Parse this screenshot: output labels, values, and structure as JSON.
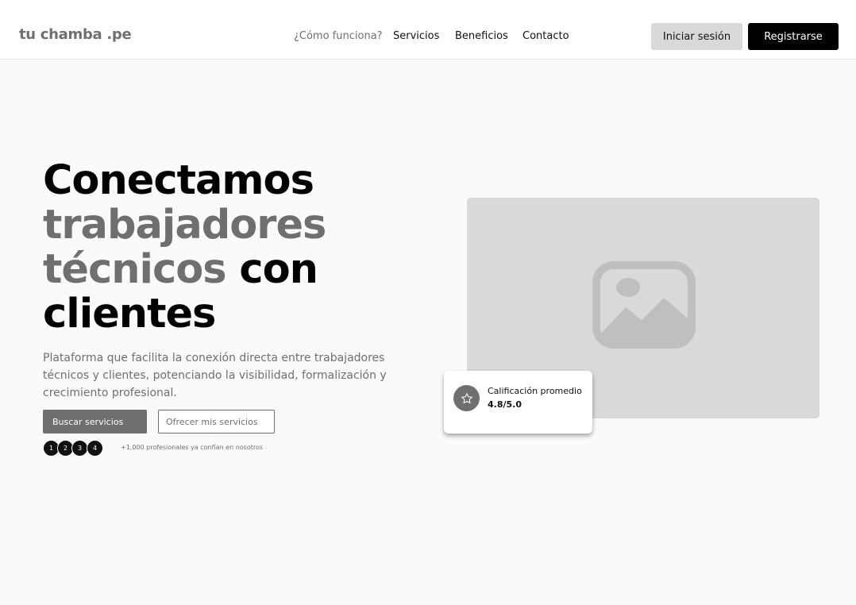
{
  "brand": {
    "logo_text": "tu chamba .pe"
  },
  "nav": {
    "links": [
      {
        "label": "¿Cómo funciona?"
      },
      {
        "label": "Servicios"
      },
      {
        "label": "Beneficios"
      },
      {
        "label": "Contacto"
      }
    ],
    "login_label": "Iniciar sesión",
    "register_label": "Registrarse"
  },
  "hero": {
    "title_line1": "Conectamos",
    "title_line2": "trabajadores",
    "title_line3_gray": "técnicos",
    "title_line3_dark": "con",
    "title_line4": "clientes",
    "description": "Plataforma que facilita la conexión directa entre trabajadores técnicos y clientes, potenciando la visibilidad, formalización y crecimiento profesional.",
    "primary_cta": "Buscar servicios",
    "secondary_cta": "Ofrecer mis servicios",
    "avatars": [
      "1",
      "2",
      "3",
      "4"
    ],
    "social_proof": "+1,000 profesionales ya confían en nosotros"
  },
  "media": {
    "icon": "image-placeholder-icon"
  },
  "rating_card": {
    "icon": "star-icon",
    "label": "Calificación promedio",
    "value": "4.8/5.0"
  },
  "colors": {
    "primary": "#000000",
    "gray_text": "#6f6f6f",
    "placeholder": "#d9d9d9",
    "background": "#fafafa"
  }
}
